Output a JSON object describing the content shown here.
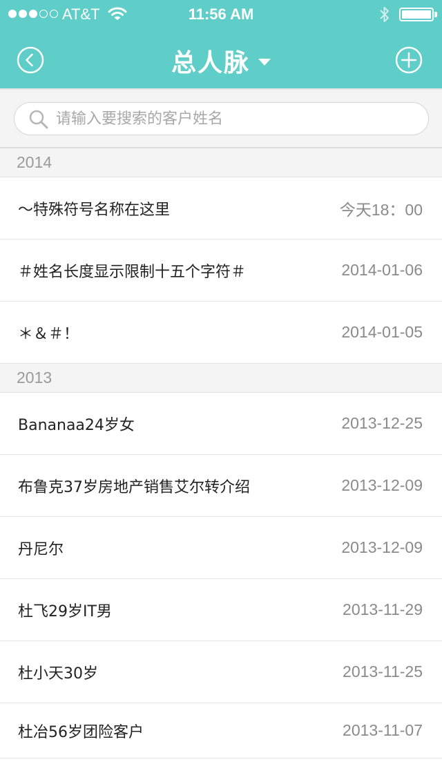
{
  "status_bar": {
    "carrier": "AT&T",
    "time": "11:56 AM",
    "signal_bars_filled": 3,
    "signal_bars_total": 5,
    "battery_level": 1.0
  },
  "header": {
    "title": "总人脉",
    "background_color": "#5fcec8",
    "back_icon": "chevron-left-circle-icon",
    "add_icon": "plus-circle-icon",
    "dropdown_icon": "caret-down-icon"
  },
  "search": {
    "placeholder": "请输入要搜索的客户姓名",
    "value": ""
  },
  "sections": [
    {
      "year": "2014",
      "items": [
        {
          "name": "～特殊符号名称在这里",
          "date": "今天18：00"
        },
        {
          "name": "＃姓名长度显示限制十五个字符＃",
          "date": "2014-01-06"
        },
        {
          "name": "＊＆＃！",
          "date": "2014-01-05"
        }
      ]
    },
    {
      "year": "2013",
      "items": [
        {
          "name": "Bananaa24岁女",
          "date": "2013-12-25"
        },
        {
          "name": "布鲁克37岁房地产销售艾尔转介绍",
          "date": "2013-12-09"
        },
        {
          "name": "丹尼尔",
          "date": "2013-12-09"
        },
        {
          "name": "杜飞29岁IT男",
          "date": "2013-11-29"
        },
        {
          "name": "杜小天30岁",
          "date": "2013-11-25"
        },
        {
          "name": "杜冶56岁团险客户",
          "date": "2013-11-07"
        }
      ]
    }
  ]
}
